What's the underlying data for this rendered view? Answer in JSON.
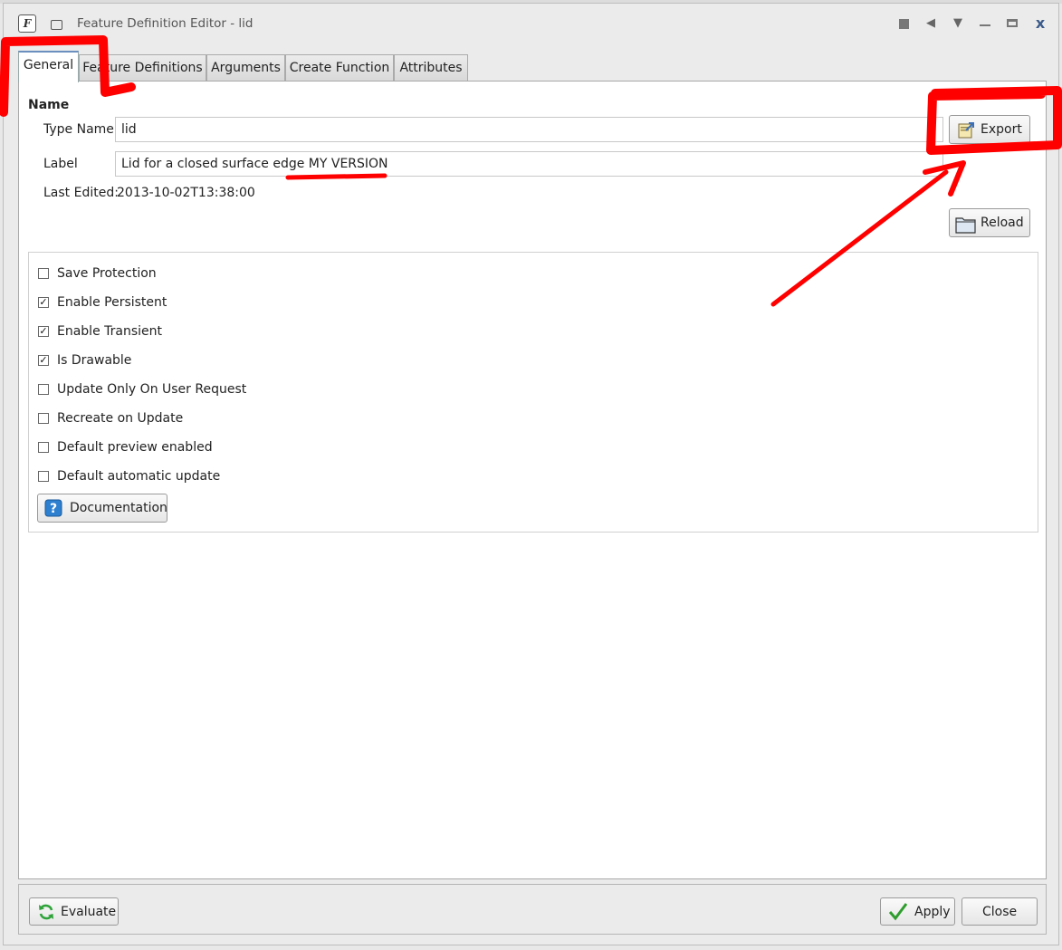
{
  "window": {
    "app_icon_letter": "F",
    "title": "Feature Definition Editor - lid"
  },
  "tabs": [
    {
      "label": "General",
      "active": true
    },
    {
      "label": "Feature Definitions",
      "active": false
    },
    {
      "label": "Arguments",
      "active": false
    },
    {
      "label": "Create Function",
      "active": false
    },
    {
      "label": "Attributes",
      "active": false
    }
  ],
  "general": {
    "section_title": "Name",
    "type_name_label": "Type Name",
    "type_name_value": "lid",
    "label_label": "Label",
    "label_value": "Lid for a closed surface edge MY VERSION",
    "last_edited_label": "Last Edited:",
    "last_edited_value": "2013-10-02T13:38:00",
    "export_label": "Export",
    "reload_label": "Reload",
    "options": [
      {
        "label": "Save Protection",
        "checked": false
      },
      {
        "label": "Enable Persistent",
        "checked": true
      },
      {
        "label": "Enable Transient",
        "checked": true
      },
      {
        "label": "Is Drawable",
        "checked": true
      },
      {
        "label": "Update Only On User Request",
        "checked": false
      },
      {
        "label": "Recreate on Update",
        "checked": false
      },
      {
        "label": "Default preview enabled",
        "checked": false
      },
      {
        "label": "Default automatic update",
        "checked": false
      }
    ],
    "documentation_label": "Documentation"
  },
  "footer": {
    "evaluate_label": "Evaluate",
    "apply_label": "Apply",
    "close_label": "Close"
  },
  "colors": {
    "annotation": "#ff0000",
    "tab_accent": "#6b8fbf"
  }
}
